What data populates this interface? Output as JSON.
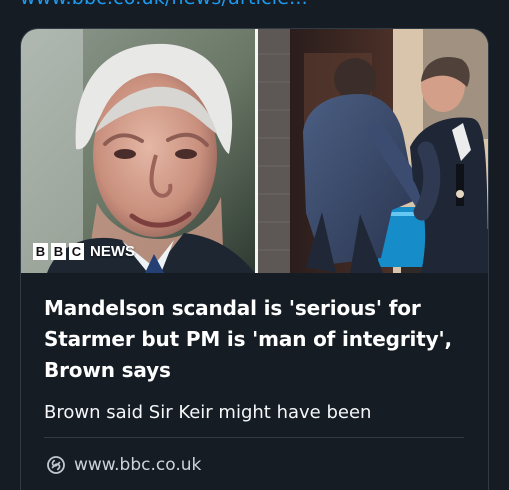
{
  "top_link": {
    "text": "www.bbc.co.uk/news/article..."
  },
  "card": {
    "source_logo": {
      "blocks": [
        "B",
        "B",
        "C"
      ],
      "news_label": "NEWS"
    },
    "headline": "Mandelson scandal is 'serious' for Starmer but PM is 'man of integrity', Brown says",
    "description": "Brown said Sir Keir might have been",
    "domain": "www.bbc.co.uk",
    "domain_icon": "link-icon"
  },
  "colors": {
    "background": "#151c24",
    "card_border": "#313b46",
    "link_blue": "#1d9bf0",
    "headline": "#ffffff",
    "domain_text": "#cdd3da"
  }
}
